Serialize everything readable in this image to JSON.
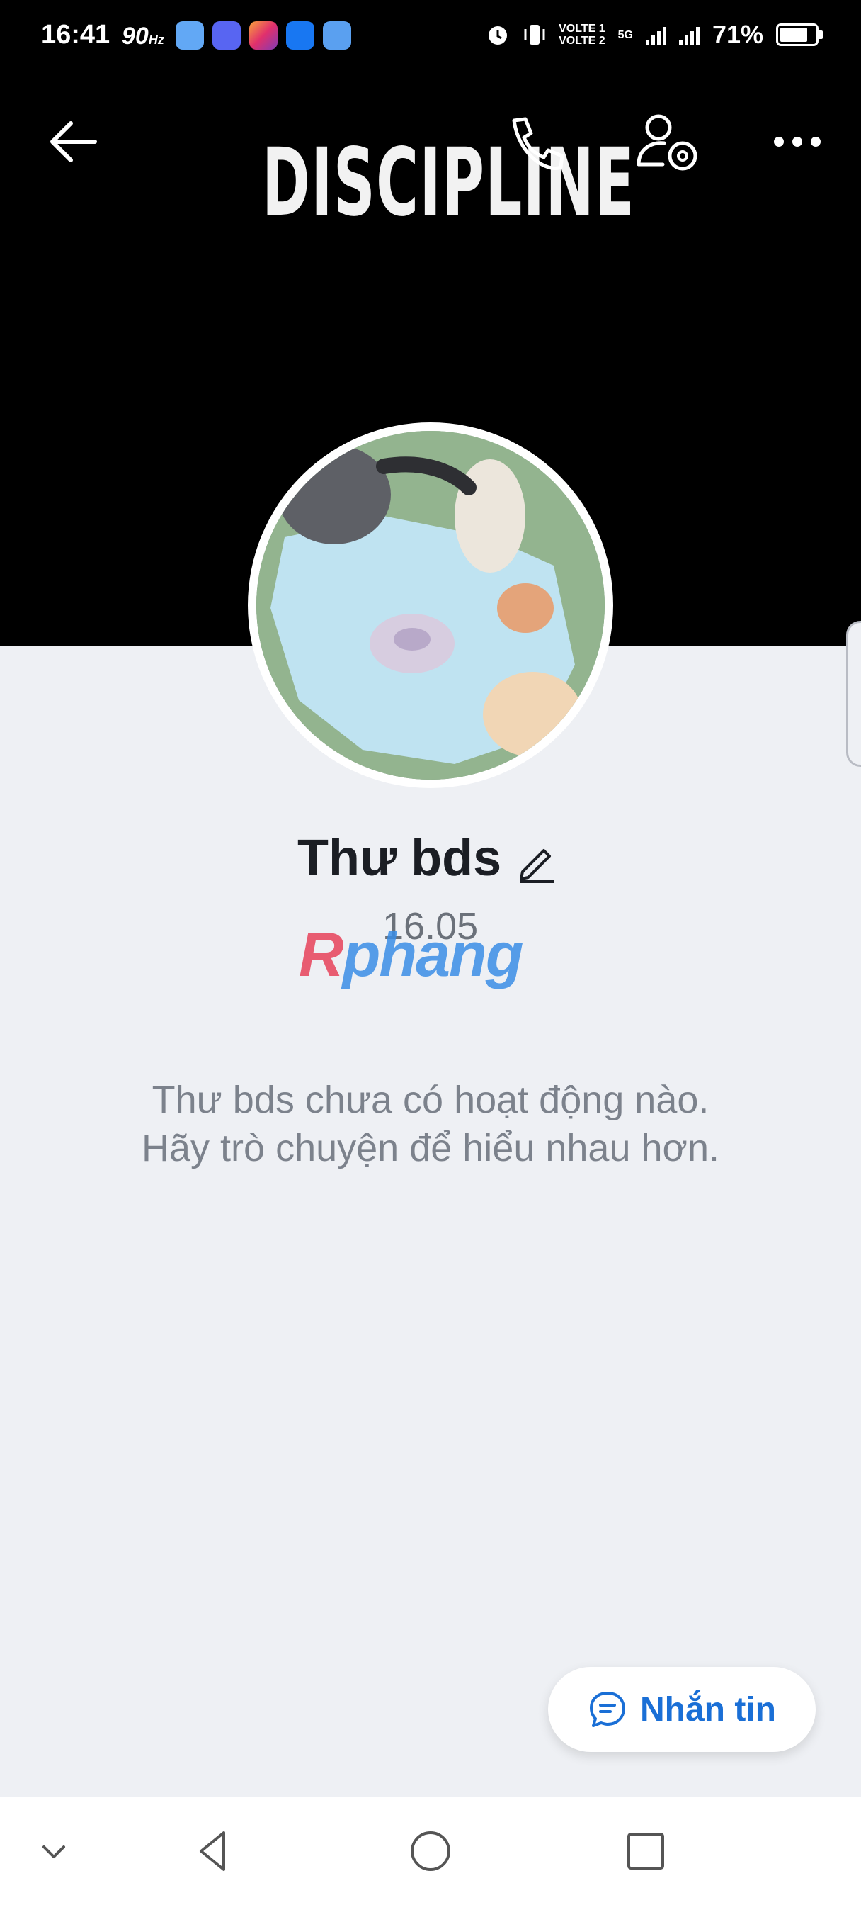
{
  "status_bar": {
    "time": "16:41",
    "refresh_rate": "90",
    "refresh_unit": "Hz",
    "network": "5G",
    "volte_1": "VOLTE 1",
    "volte_2": "VOLTE 2",
    "battery": "71%"
  },
  "notification_icons": [
    {
      "name": "messenger-icon",
      "color": "#62a8f5"
    },
    {
      "name": "discord-icon",
      "color": "#5865f2"
    },
    {
      "name": "instagram-icon",
      "color": "#e1306c"
    },
    {
      "name": "facebook-icon",
      "color": "#1877f2"
    },
    {
      "name": "browser-icon",
      "color": "#5aa0f0"
    }
  ],
  "header": {
    "cover_text": "DISCIPLINE",
    "back_icon": "arrow-left-icon",
    "call_icon": "phone-icon",
    "settings_icon": "user-settings-icon",
    "more_icon": "more-horizontal-icon"
  },
  "profile": {
    "name": "Thư bds",
    "birthday": "16.05",
    "edit_icon": "pencil-icon"
  },
  "watermark": {
    "text_a": "R",
    "text_b": "phang"
  },
  "empty_state": {
    "line1": "Thư bds chưa có hoạt động nào.",
    "line2": "Hãy trò chuyện để hiểu nhau hơn."
  },
  "actions": {
    "message_label": "Nhắn tin",
    "message_icon": "chat-bubble-icon"
  },
  "colors": {
    "accent": "#1a6fd6",
    "cover_bg": "#000000",
    "page_bg": "#eef0f4"
  }
}
